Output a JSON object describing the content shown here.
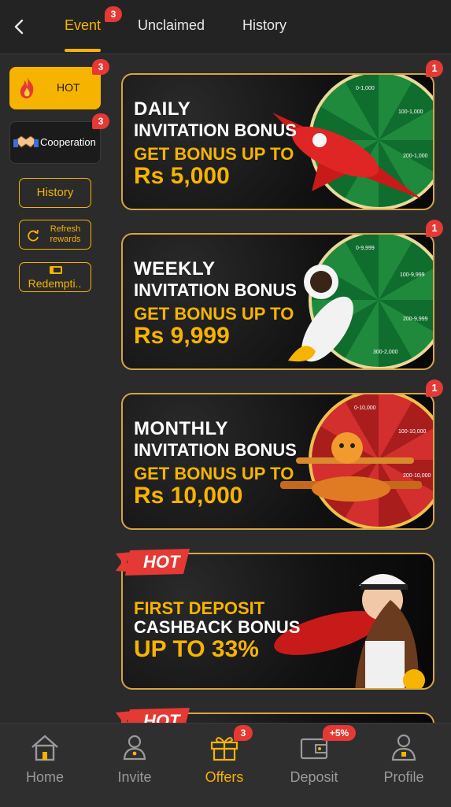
{
  "header": {
    "tabs": [
      {
        "label": "Event",
        "badge": "3",
        "active": true
      },
      {
        "label": "Unclaimed"
      },
      {
        "label": "History"
      }
    ]
  },
  "sidebar": {
    "categories": [
      {
        "label": "HOT",
        "badge": "3",
        "active": true,
        "icon": "flame-icon"
      },
      {
        "label": "Cooperation",
        "badge": "3",
        "icon": "handshake-icon"
      }
    ],
    "buttons": [
      {
        "label": "History"
      },
      {
        "label": "Refresh rewards",
        "icon": "refresh-icon"
      },
      {
        "label": "Redempti..",
        "icon": "ticket-icon"
      }
    ]
  },
  "banners": [
    {
      "line1": "DAILY",
      "line2": "INVITATION BONUS",
      "line3": "GET BONUS UP TO",
      "line4": "Rs 5,000",
      "badge": "1",
      "wheel_labels": [
        "0-1,000",
        "100-1,000",
        "200-1,000"
      ]
    },
    {
      "line1": "WEEKLY",
      "line2": "INVITATION BONUS",
      "line3": "GET BONUS UP TO",
      "line4": "Rs 9,999",
      "badge": "1",
      "wheel_labels": [
        "0-9,999",
        "100-9,999",
        "200-9,999",
        "300-2,000"
      ]
    },
    {
      "line1": "MONTHLY",
      "line2": "INVITATION BONUS",
      "line3": "GET BONUS UP TO",
      "line4": "Rs 10,000",
      "badge": "1",
      "wheel_labels": [
        "0-10,000",
        "100-10,000",
        "200-10,000"
      ]
    },
    {
      "ribbon": "HOT",
      "line1": "FIRST DEPOSIT",
      "line2": "CASHBACK BONUS",
      "line3": "UP TO 33%"
    }
  ],
  "next_banner_ribbon": "HOT",
  "bottom_nav": [
    {
      "label": "Home",
      "icon": "home-icon"
    },
    {
      "label": "Invite",
      "icon": "invite-icon"
    },
    {
      "label": "Offers",
      "icon": "gift-icon",
      "badge": "3",
      "active": true
    },
    {
      "label": "Deposit",
      "icon": "wallet-icon",
      "badge": "+5%"
    },
    {
      "label": "Profile",
      "icon": "profile-icon"
    }
  ],
  "colors": {
    "accent": "#f6b300",
    "badge": "#e53935",
    "background": "#2b2b2b"
  }
}
